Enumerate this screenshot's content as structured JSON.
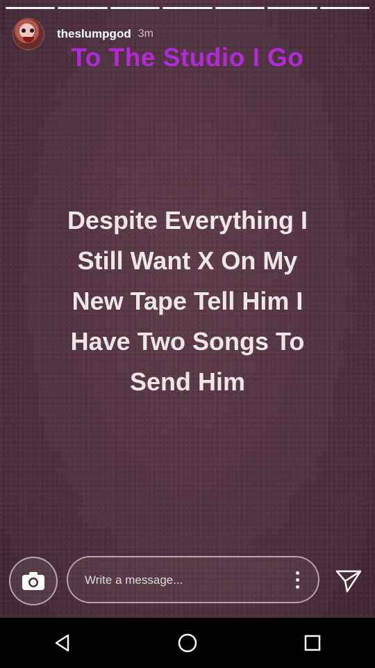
{
  "story": {
    "progress_segments": [
      {
        "state": "done"
      },
      {
        "state": "done"
      },
      {
        "state": "done"
      },
      {
        "state": "done"
      },
      {
        "state": "done"
      },
      {
        "state": "done"
      },
      {
        "state": "done"
      }
    ],
    "username": "theslumpgod",
    "timestamp": "3m",
    "title": "To The Studio I Go",
    "title_color": "#b02ad6",
    "body_lines": [
      "Despite Everything I",
      "Still Want X On My",
      "New Tape Tell Him I",
      "Have Two Songs To",
      "Send Him"
    ]
  },
  "reply_bar": {
    "camera_icon": "camera-icon",
    "message_placeholder": "Write a message...",
    "message_value": "",
    "more_icon": "more-vertical-icon",
    "send_icon": "send-icon"
  },
  "nav_bar": {
    "back_icon": "back-icon",
    "home_icon": "home-icon",
    "recents_icon": "recents-icon"
  }
}
